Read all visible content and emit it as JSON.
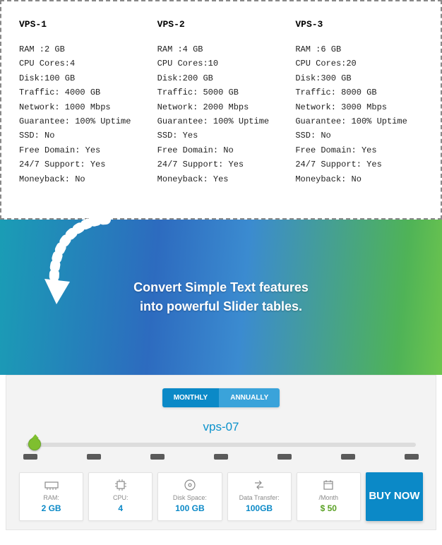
{
  "plans": [
    {
      "title": "VPS-1",
      "specs": [
        "RAM :2 GB",
        "CPU Cores:4",
        "Disk:100 GB",
        "Traffic: 4000 GB",
        "Network: 1000 Mbps",
        "Guarantee: 100% Uptime",
        "SSD: No",
        "Free Domain: Yes",
        "24/7 Support: Yes",
        "Moneyback: No"
      ]
    },
    {
      "title": "VPS-2",
      "specs": [
        "RAM :4 GB",
        "CPU Cores:10",
        "Disk:200 GB",
        "Traffic: 5000 GB",
        "Network: 2000 Mbps",
        "Guarantee: 100% Uptime",
        "SSD: Yes",
        "Free Domain: No",
        "24/7 Support: Yes",
        "Moneyback: Yes"
      ]
    },
    {
      "title": "VPS-3",
      "specs": [
        "RAM :6 GB",
        "CPU Cores:20",
        "Disk:300 GB",
        "Traffic: 8000 GB",
        "Network: 3000 Mbps",
        "Guarantee: 100% Uptime",
        "SSD: No",
        "Free Domain: Yes",
        "24/7 Support: Yes",
        "Moneyback: No"
      ]
    }
  ],
  "headline_l1": "Convert Simple Text features",
  "headline_l2": "into powerful Slider tables.",
  "toggle": {
    "monthly": "MONTHLY",
    "annually": "ANNUALLY"
  },
  "slider_plan": "vps-07",
  "cards": {
    "ram": {
      "label": "RAM:",
      "value": "2 GB"
    },
    "cpu": {
      "label": "CPU:",
      "value": "4"
    },
    "disk": {
      "label": "Disk Space:",
      "value": "100 GB"
    },
    "transfer": {
      "label": "Data Transfer:",
      "value": "100GB"
    },
    "price": {
      "label": "/Month",
      "value": "$ 50"
    }
  },
  "buy": "BUY NOW"
}
